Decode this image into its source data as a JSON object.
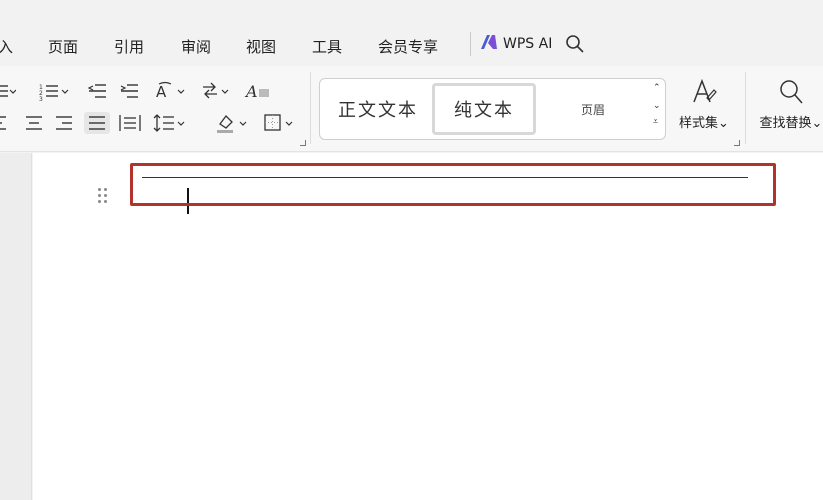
{
  "menu": {
    "items": [
      "入",
      "页面",
      "引用",
      "审阅",
      "视图",
      "工具",
      "会员专享"
    ],
    "ai_label": "WPS AI"
  },
  "styles": {
    "normal": "正文文本",
    "plain": "纯文本",
    "header": "页眉"
  },
  "ribbon": {
    "style_set_label": "样式集",
    "find_replace_label": "查找替换"
  },
  "colors": {
    "highlight": "#b0342b",
    "ai_logo": "#4a5bd4"
  }
}
